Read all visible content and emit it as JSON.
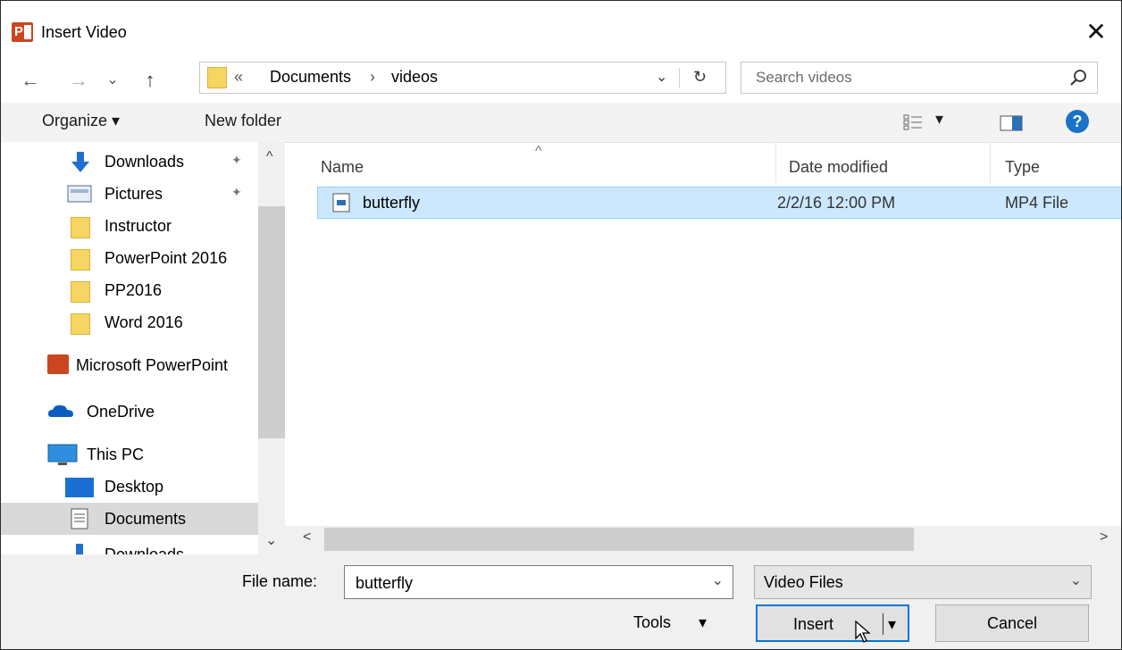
{
  "window": {
    "title": "Insert Video",
    "app_logo_text": "P",
    "close_glyph": "✕"
  },
  "nav": {
    "back": "←",
    "forward": "→",
    "recent": "⌄",
    "up": "↑",
    "breadcrumb_overflow": "«",
    "breadcrumb": [
      "Documents",
      "videos"
    ],
    "breadcrumb_sep": "›",
    "address_dropdown": "⌄",
    "refresh": "↻",
    "search_placeholder": "Search videos"
  },
  "toolbar": {
    "organize": "Organize ▾",
    "new_folder": "New folder",
    "view_dropdown": "▾",
    "help": "?"
  },
  "sidebar": {
    "items": [
      {
        "label": "Downloads",
        "icon": "download-icon",
        "pinned": true
      },
      {
        "label": "Pictures",
        "icon": "pictures-icon",
        "pinned": true
      },
      {
        "label": "Instructor",
        "icon": "folder-icon"
      },
      {
        "label": "PowerPoint 2016",
        "icon": "folder-icon"
      },
      {
        "label": "PP2016",
        "icon": "folder-icon"
      },
      {
        "label": "Word 2016",
        "icon": "folder-icon"
      },
      {
        "label": "Microsoft PowerPoint",
        "icon": "powerpoint-icon"
      },
      {
        "label": "OneDrive",
        "icon": "onedrive-icon"
      },
      {
        "label": "This PC",
        "icon": "computer-icon"
      },
      {
        "label": "Desktop",
        "icon": "desktop-icon"
      },
      {
        "label": "Documents",
        "icon": "documents-icon",
        "selected": true
      },
      {
        "label": "Downloads",
        "icon": "download-icon"
      }
    ],
    "scroll_up": "^",
    "scroll_down": "⌄",
    "pin_glyph": "📌"
  },
  "files": {
    "columns": [
      "Name",
      "Date modified",
      "Type"
    ],
    "sort_indicator": "^",
    "rows": [
      {
        "name": "butterfly",
        "date": "2/2/16 12:00 PM",
        "type": "MP4 File",
        "selected": true
      }
    ],
    "scroll_left": "<",
    "scroll_right": ">"
  },
  "footer": {
    "file_name_label": "File name:",
    "file_name_value": "butterfly",
    "file_type": "Video Files",
    "tools": "Tools",
    "tools_arrow": "▾",
    "insert": "Insert",
    "insert_split_arrow": "▾",
    "cancel": "Cancel"
  },
  "colors": {
    "selection_bg": "#cce8ff",
    "selection_border": "#99d1ff",
    "accent": "#0078d7",
    "folder": "#f6d563",
    "ppt": "#c9461f"
  }
}
